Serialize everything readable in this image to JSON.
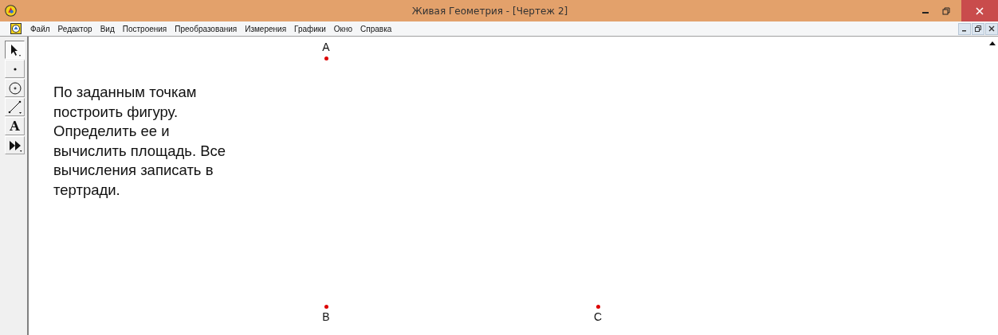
{
  "window": {
    "title": "Живая Геометрия - [Чертеж 2]"
  },
  "menu": [
    "Файл",
    "Редактор",
    "Вид",
    "Построения",
    "Преобразования",
    "Измерения",
    "Графики",
    "Окно",
    "Справка"
  ],
  "tools": [
    {
      "kind": "arrow",
      "selected": true
    },
    {
      "kind": "point",
      "selected": false
    },
    {
      "kind": "compass",
      "selected": false
    },
    {
      "kind": "segment",
      "selected": false
    },
    {
      "kind": "text",
      "glyph": "A",
      "selected": false
    },
    {
      "kind": "custom",
      "selected": false
    }
  ],
  "canvas": {
    "note": "По заданным точкам\nпостроить фигуру.\nОпределить ее и\nвычислить площадь. Все\nвычисления записать в\nтертради.",
    "points": [
      {
        "label": "A"
      },
      {
        "label": "B"
      },
      {
        "label": "C"
      }
    ]
  }
}
